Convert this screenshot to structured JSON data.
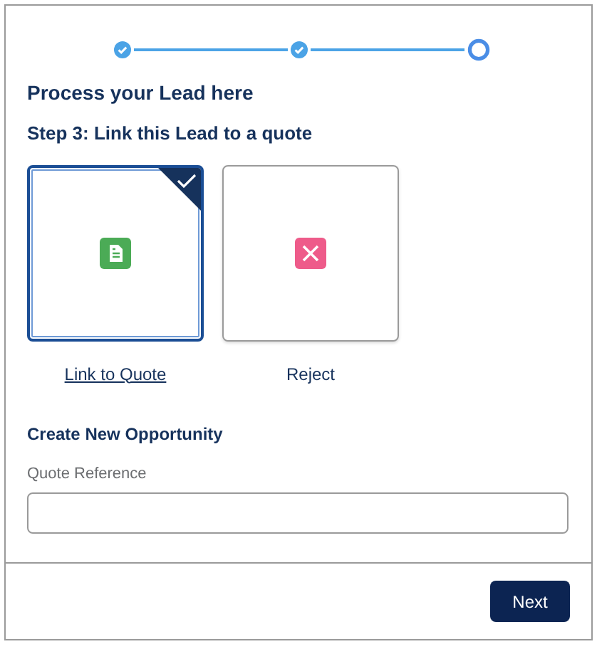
{
  "steps": [
    {
      "completed": true
    },
    {
      "completed": true
    },
    {
      "completed": false
    }
  ],
  "title": "Process your Lead here",
  "subtitle": "Step 3: Link this Lead to a quote",
  "options": [
    {
      "kind": "quote",
      "label": "Link to Quote",
      "selected": true
    },
    {
      "kind": "reject",
      "label": "Reject",
      "selected": false
    }
  ],
  "section_title": "Create New Opportunity",
  "field": {
    "label": "Quote Reference"
  },
  "buttons": [
    "Next"
  ]
}
